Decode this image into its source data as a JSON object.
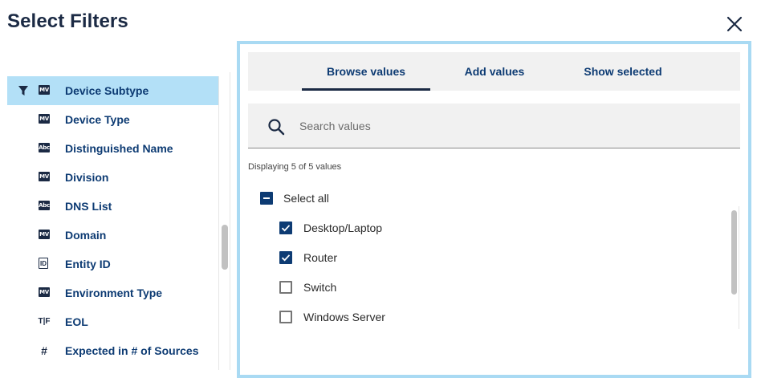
{
  "dialog": {
    "title": "Select Filters"
  },
  "fields": [
    {
      "label": "Device Subtype",
      "type_icon": "mv",
      "type_text": "MV",
      "selected": true
    },
    {
      "label": "Device Type",
      "type_icon": "mv",
      "type_text": "MV"
    },
    {
      "label": "Distinguished Name",
      "type_icon": "abc",
      "type_text": "Abc"
    },
    {
      "label": "Division",
      "type_icon": "mv",
      "type_text": "MV"
    },
    {
      "label": "DNS List",
      "type_icon": "abc",
      "type_text": "Abc"
    },
    {
      "label": "Domain",
      "type_icon": "mv",
      "type_text": "MV"
    },
    {
      "label": "Entity ID",
      "type_icon": "id",
      "type_text": "ID"
    },
    {
      "label": "Environment Type",
      "type_icon": "mv",
      "type_text": "MV"
    },
    {
      "label": "EOL",
      "type_icon": "boolean-tf",
      "type_text": "T|F"
    },
    {
      "label": "Expected in # of Sources",
      "type_icon": "hash",
      "type_text": "#"
    }
  ],
  "tabs": [
    {
      "label": "Browse values",
      "active": true
    },
    {
      "label": "Add values"
    },
    {
      "label": "Show selected"
    }
  ],
  "search": {
    "placeholder": "Search values",
    "value": ""
  },
  "values_count_text": "Displaying 5 of 5 values",
  "select_all": {
    "label": "Select all",
    "state": "indeterminate"
  },
  "values": [
    {
      "label": "Desktop/Laptop",
      "checked": true
    },
    {
      "label": "Router",
      "checked": true
    },
    {
      "label": "Switch",
      "checked": false
    },
    {
      "label": "Windows Server",
      "checked": false
    }
  ],
  "colors": {
    "accent": "#0d3b73",
    "selected_row": "#b3e0f7",
    "panel_border": "#a9daf3",
    "title": "#1b2a44"
  }
}
